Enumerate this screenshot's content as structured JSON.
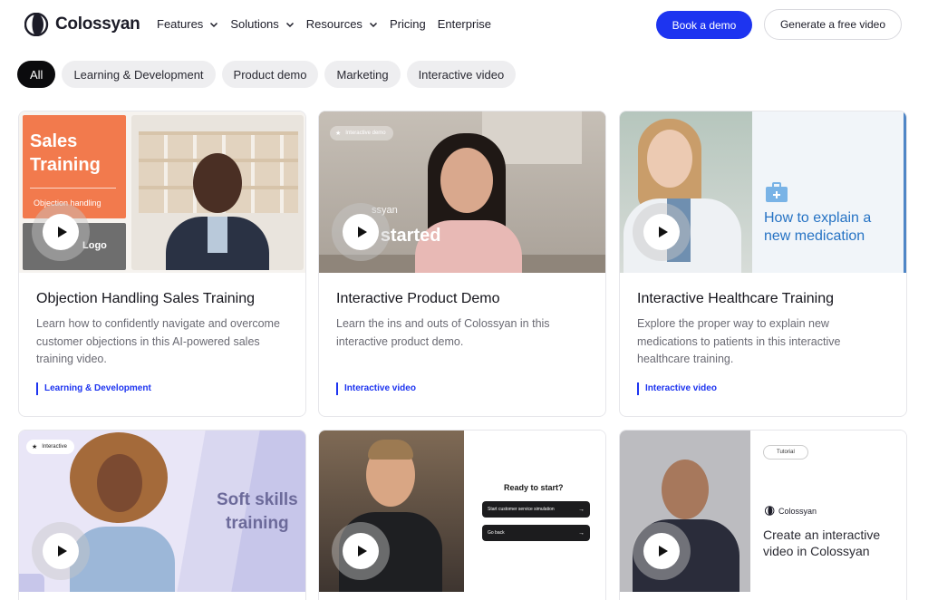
{
  "nav": {
    "logo_text": "Colossyan",
    "menu": [
      {
        "label": "Features",
        "has_dropdown": true
      },
      {
        "label": "Solutions",
        "has_dropdown": true
      },
      {
        "label": "Resources",
        "has_dropdown": true
      },
      {
        "label": "Pricing",
        "has_dropdown": false
      },
      {
        "label": "Enterprise",
        "has_dropdown": false
      }
    ],
    "book_demo": "Book a demo",
    "free_video": "Generate a free video"
  },
  "filters": [
    "All",
    "Learning & Development",
    "Product demo",
    "Marketing",
    "Interactive video"
  ],
  "active_filter": "All",
  "cards": [
    {
      "title": "Objection Handling Sales Training",
      "description": "Learn how to confidently navigate and overcome customer objections in this AI-powered sales training video.",
      "tag": "Learning & Development",
      "thumb": {
        "heading_line1": "Sales",
        "heading_line2": "Training",
        "subheading": "Objection handling",
        "logo_text": "Logo"
      }
    },
    {
      "title": "Interactive Product Demo",
      "description": "Learn the ins and outs of Colossyan in this interactive product demo.",
      "tag": "Interactive video",
      "thumb": {
        "badge": "Interactive demo",
        "brand": "ssyan",
        "overlay": "g started"
      }
    },
    {
      "title": "Interactive Healthcare Training",
      "description": "Explore the proper way to explain new medications to patients in this interactive healthcare training.",
      "tag": "Interactive video",
      "thumb": {
        "heading": "How to explain a new medication"
      }
    },
    {
      "thumb": {
        "badge": "Interactive",
        "heading_line1": "Soft skills",
        "heading_line2": "training"
      }
    },
    {
      "thumb": {
        "heading": "Ready to start?",
        "option1": "Start customer service simulation",
        "option2": "Go back"
      }
    },
    {
      "thumb": {
        "badge": "Tutorial",
        "brand": "Colossyan",
        "heading": "Create an interactive video in Colossyan"
      }
    }
  ],
  "colors": {
    "accent": "#1d34f0",
    "sales_orange": "#f27a4d",
    "soft_lavender": "#c7c6ea"
  }
}
